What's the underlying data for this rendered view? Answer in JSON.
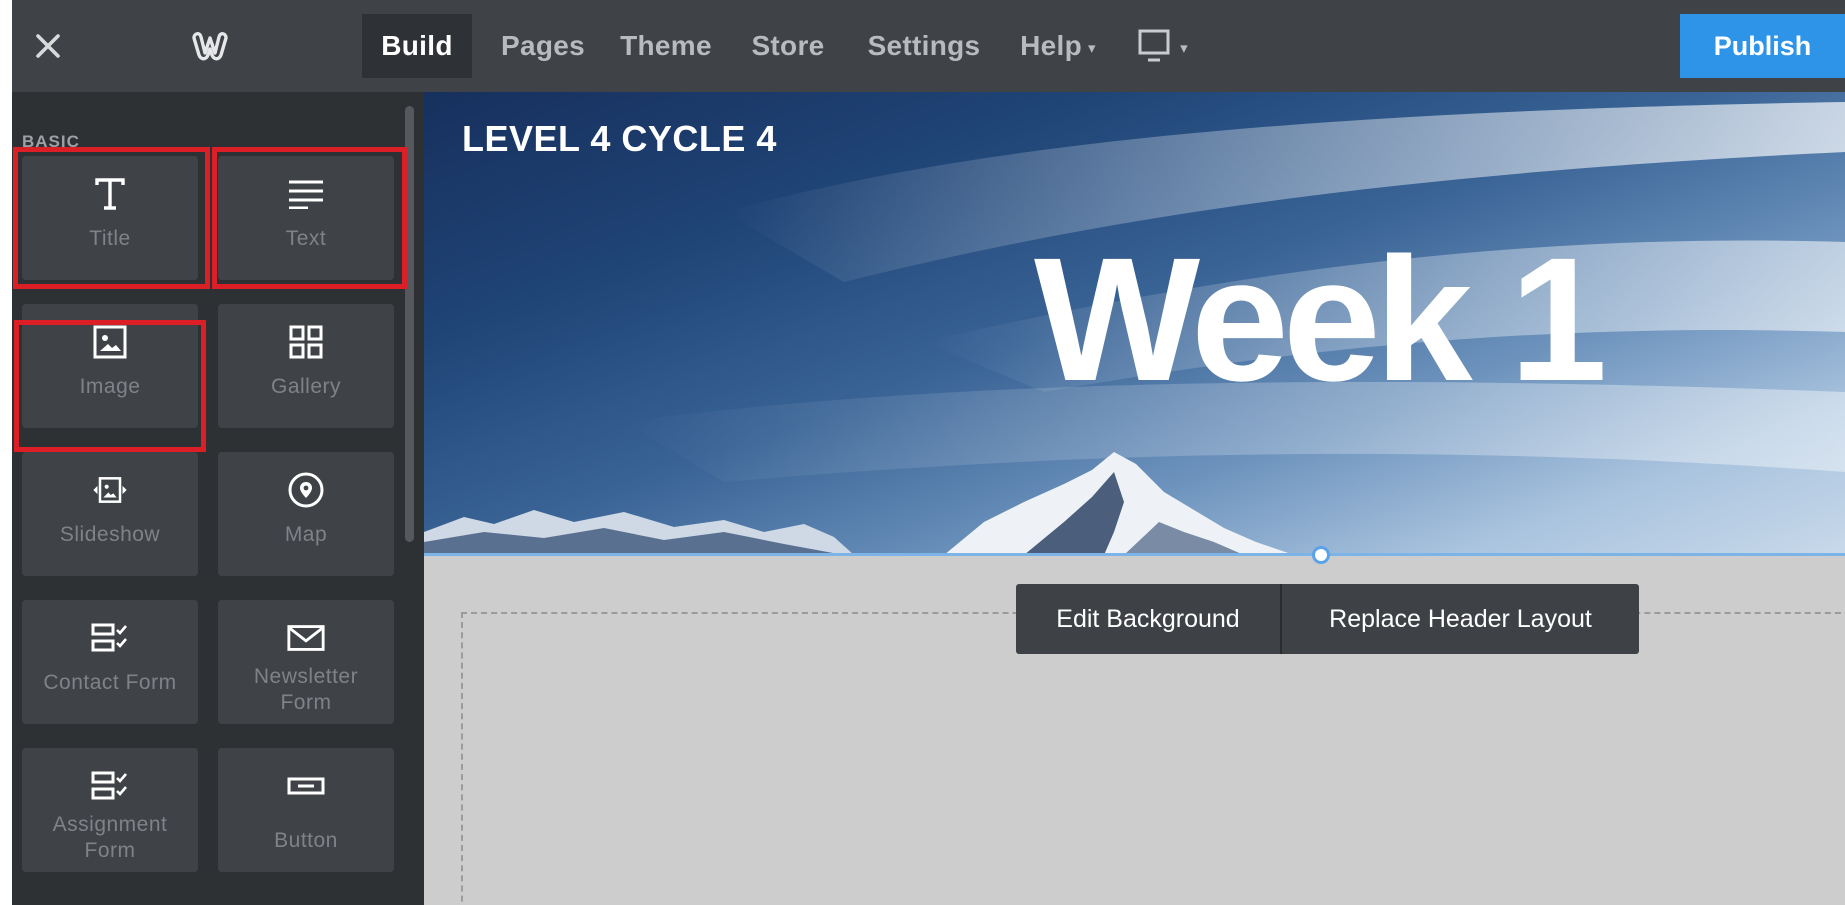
{
  "topbar": {
    "close_icon": "close-icon",
    "logo_icon": "weebly-logo-icon",
    "nav": [
      {
        "label": "Build",
        "active": true
      },
      {
        "label": "Pages",
        "active": false
      },
      {
        "label": "Theme",
        "active": false
      },
      {
        "label": "Store",
        "active": false
      },
      {
        "label": "Settings",
        "active": false
      },
      {
        "label": "Help",
        "active": false,
        "caret": "▾"
      }
    ],
    "device_icon": "desktop-device-icon",
    "device_caret": "▾",
    "publish_label": "Publish"
  },
  "sidebar": {
    "heading": "BASIC",
    "elements": [
      {
        "label": "Title",
        "icon": "title-icon",
        "highlighted": true
      },
      {
        "label": "Text",
        "icon": "text-icon",
        "highlighted": true
      },
      {
        "label": "Image",
        "icon": "image-icon",
        "highlighted": true
      },
      {
        "label": "Gallery",
        "icon": "gallery-icon",
        "highlighted": false
      },
      {
        "label": "Slideshow",
        "icon": "slideshow-icon",
        "highlighted": false
      },
      {
        "label": "Map",
        "icon": "map-pin-icon",
        "highlighted": false
      },
      {
        "label": "Contact Form",
        "icon": "contact-form-icon",
        "highlighted": false
      },
      {
        "label_line1": "Newsletter",
        "label_line2": "Form",
        "icon": "envelope-icon",
        "highlighted": false
      },
      {
        "label_line1": "Assignment",
        "label_line2": "Form",
        "icon": "assignment-form-icon",
        "highlighted": false
      },
      {
        "label": "Button",
        "icon": "button-icon",
        "highlighted": false
      }
    ]
  },
  "canvas": {
    "header_small": "LEVEL 4 CYCLE 4",
    "header_big": "Week 1",
    "popover": {
      "edit_background": "Edit Background",
      "replace_header": "Replace Header Layout"
    }
  },
  "colors": {
    "publish": "#2d94e8",
    "highlight": "#dc1f26",
    "topbar": "#3f4246",
    "sidebar": "#2e3134",
    "tile": "#3f4347"
  }
}
